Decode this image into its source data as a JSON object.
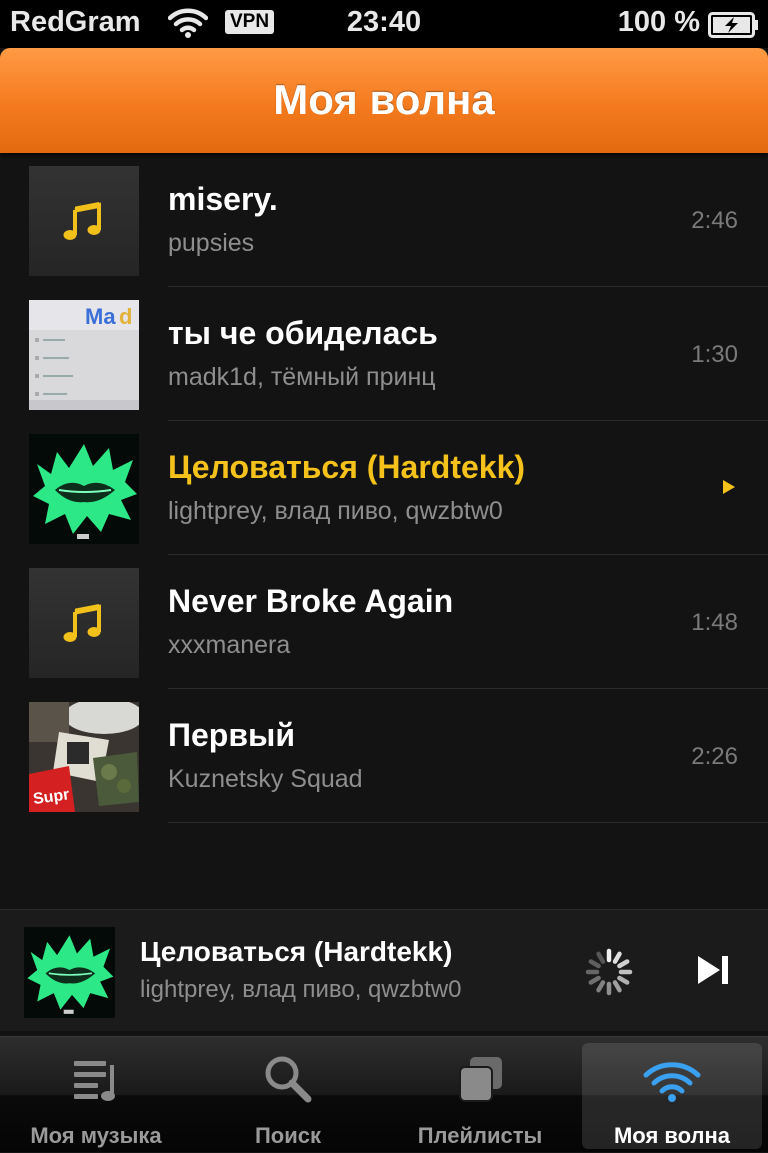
{
  "status_bar": {
    "carrier": "RedGram",
    "vpn": "VPN",
    "time": "23:40",
    "battery": "100 %"
  },
  "header": {
    "title": "Моя волна"
  },
  "tracks": [
    {
      "title": "misery.",
      "artist": "pupsies",
      "duration": "2:46",
      "artwork": "music-note-placeholder",
      "playing": false
    },
    {
      "title": "ты че обиделась",
      "artist": "madk1d, тёмный принц",
      "duration": "1:30",
      "artwork": "photo-screen",
      "playing": false
    },
    {
      "title": "Целоваться (Hardtekk)",
      "artist": "lightprey, влад пиво, qwzbtw0",
      "duration": "",
      "artwork": "neon-lips",
      "playing": true
    },
    {
      "title": "Never Broke Again",
      "artist": "xxxmanera",
      "duration": "1:48",
      "artwork": "music-note-placeholder",
      "playing": false
    },
    {
      "title": "Первый",
      "artist": "Kuznetsky Squad",
      "duration": "2:26",
      "artwork": "photo-collage",
      "playing": false
    }
  ],
  "now_playing": {
    "title": "Целоваться (Hardtekk)",
    "artist": "lightprey, влад пиво, qwzbtw0",
    "artwork": "neon-lips"
  },
  "tabs": [
    {
      "label": "Моя музыка",
      "icon": "music-list-icon",
      "active": false
    },
    {
      "label": "Поиск",
      "icon": "search-icon",
      "active": false
    },
    {
      "label": "Плейлисты",
      "icon": "playlists-icon",
      "active": false
    },
    {
      "label": "Моя волна",
      "icon": "wave-icon",
      "active": true
    }
  ],
  "colors": {
    "accent_orange": "#f57a1e",
    "active_yellow": "#f4c21b",
    "wave_blue": "#3aa0f0",
    "neon_green": "#3dff9a"
  }
}
